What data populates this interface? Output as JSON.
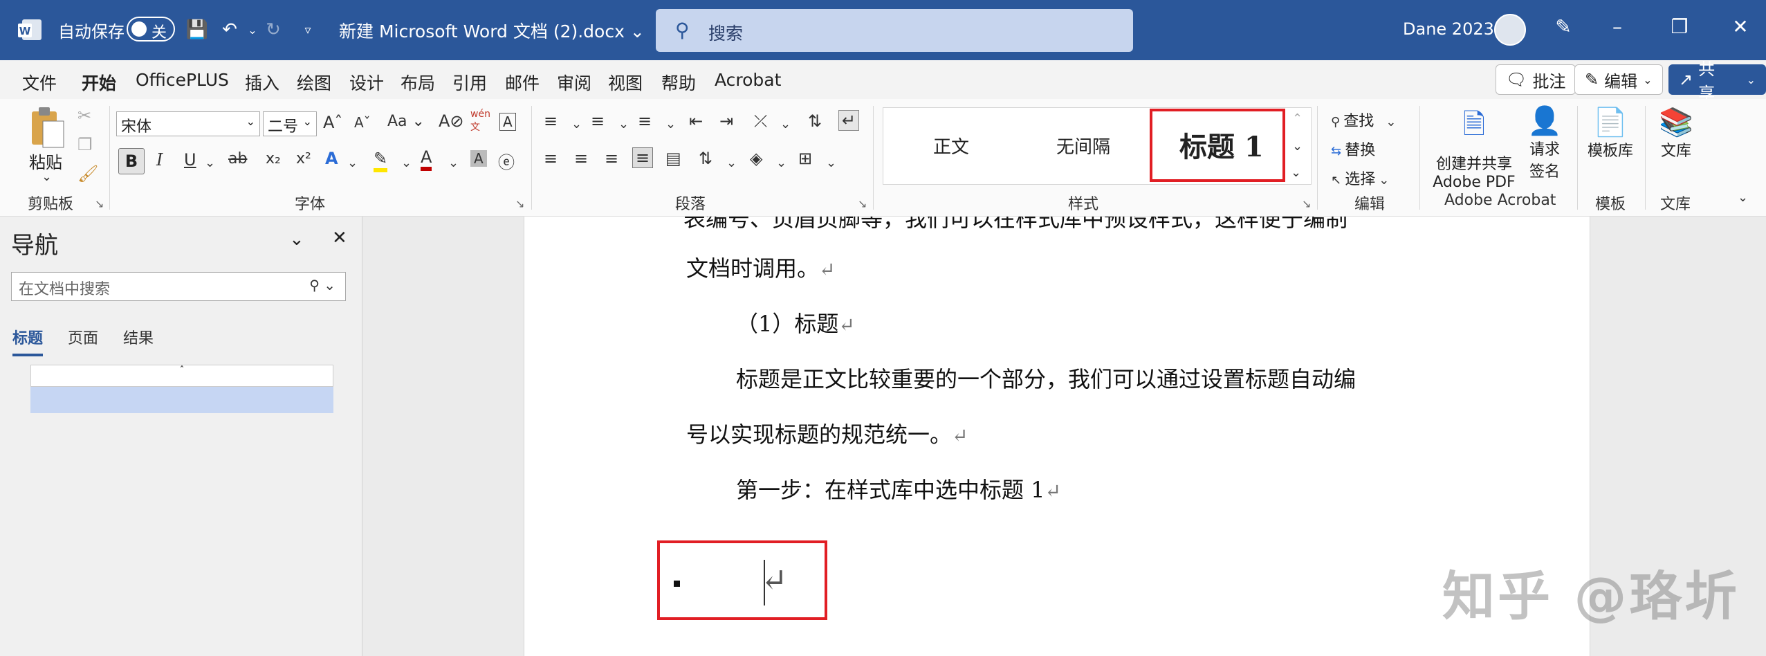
{
  "titlebar": {
    "autosave_label": "自动保存",
    "toggle_state": "关",
    "doc_title": "新建 Microsoft Word 文档 (2).docx",
    "search_placeholder": "搜索",
    "user_name": "Dane 2023"
  },
  "menu": {
    "items": [
      "文件",
      "开始",
      "OfficePLUS",
      "插入",
      "绘图",
      "设计",
      "布局",
      "引用",
      "邮件",
      "审阅",
      "视图",
      "帮助",
      "Acrobat"
    ],
    "active": "开始",
    "comment_label": "批注",
    "edit_label": "编辑",
    "share_label": "共享"
  },
  "ribbon": {
    "paste_label": "粘贴",
    "font_name": "宋体",
    "font_size": "二号",
    "groups": {
      "clipboard": "剪贴板",
      "font": "字体",
      "paragraph": "段落",
      "styles": "样式",
      "editing": "编辑",
      "adobe": "Adobe Acrobat",
      "template": "模板",
      "library": "文库"
    },
    "styles": [
      "正文",
      "无间隔",
      "标题 1"
    ],
    "find_label": "查找",
    "replace_label": "替换",
    "select_label": "选择",
    "adobe_create_line1": "创建并共享",
    "adobe_create_line2": "Adobe PDF",
    "adobe_sign_line1": "请求",
    "adobe_sign_line2": "签名",
    "template_btn": "模板库",
    "library_btn": "文库",
    "aa_label": "Aa",
    "wen_label": "wén"
  },
  "nav": {
    "title": "导航",
    "search_placeholder": "在文档中搜索",
    "tabs": [
      "标题",
      "页面",
      "结果"
    ],
    "active_tab": "标题"
  },
  "document": {
    "cut_line": "表编号、页眉页脚等，我们可以在样式库中预设样式，这样便于编制",
    "lines": [
      "文档时调用。",
      "（1）标题",
      "标题是正文比较重要的一个部分，我们可以通过设置标题自动编",
      "号以实现标题的规范统一。",
      "第一步：在样式库中选中标题 1"
    ],
    "paragraph_mark": "↵"
  },
  "watermark": "知乎 @珞圻",
  "colors": {
    "accent": "#2b579a",
    "highlight_red": "#e11e24"
  }
}
